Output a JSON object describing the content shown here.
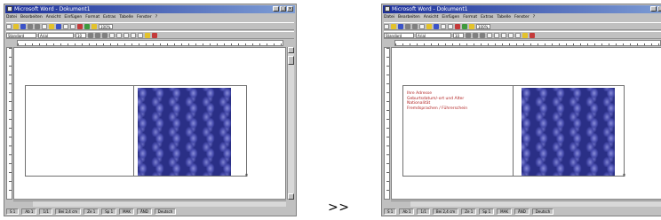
{
  "windows": [
    {
      "side": "before",
      "title": "Microsoft Word - Dokument1",
      "menu": [
        "Datei",
        "Bearbeiten",
        "Ansicht",
        "Einfügen",
        "Format",
        "Extras",
        "Tabelle",
        "Fenster",
        "?"
      ],
      "font_name": "Arial",
      "font_size": "10",
      "style_name": "Standard",
      "zoom": "100%",
      "status": [
        "S 1",
        "Ab 1",
        "1/1",
        "Bei 2,4 cm",
        "Ze 1",
        "Sp 1",
        "MAK",
        "ÄND",
        "Deutsch"
      ],
      "cell_lines": []
    },
    {
      "side": "after",
      "title": "Microsoft Word - Dokument1",
      "menu": [
        "Datei",
        "Bearbeiten",
        "Ansicht",
        "Einfügen",
        "Format",
        "Extras",
        "Tabelle",
        "Fenster",
        "?"
      ],
      "font_name": "Arial",
      "font_size": "10",
      "style_name": "Standard",
      "zoom": "100%",
      "status": [
        "S 1",
        "Ab 1",
        "1/1",
        "Bei 2,4 cm",
        "Ze 1",
        "Sp 1",
        "MAK",
        "ÄND",
        "Deutsch"
      ],
      "cell_lines": [
        "Ihre Adresse",
        "Geburtsdatum/-ort und Alter",
        "Nationalität",
        "Fremdsprachen / Führerschein"
      ]
    }
  ],
  "transition_label": ">>",
  "colors": {
    "titlebar_start": "#1c2f9a",
    "titlebar_end": "#7f9fd6",
    "window_chrome": "#c0c0c0",
    "cell_text": "#b02020",
    "texture_base": "#2a2f86"
  },
  "icons": [
    "app-icon",
    "minimize-icon",
    "maximize-icon",
    "close-icon",
    "new-document-icon",
    "open-icon",
    "save-icon",
    "print-icon",
    "bold-icon",
    "italic-icon",
    "underline-icon",
    "align-icon",
    "scroll-up-icon",
    "scroll-down-icon"
  ]
}
